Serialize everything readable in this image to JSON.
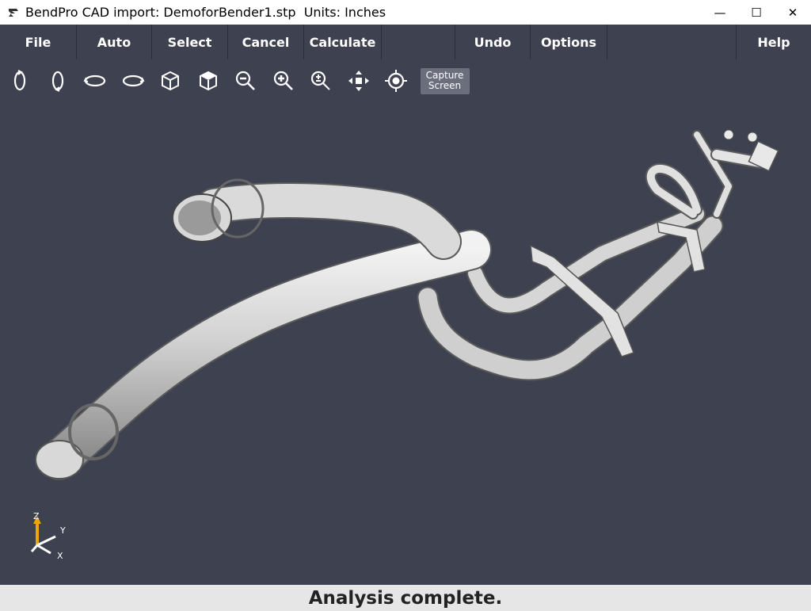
{
  "window": {
    "title": "BendPro CAD import: DemoforBender1.stp  Units: Inches",
    "minimize": "—",
    "maximize": "☐",
    "close": "✕"
  },
  "menu": {
    "items": [
      {
        "label": "File",
        "width": 97
      },
      {
        "label": "Auto",
        "width": 95
      },
      {
        "label": "Select",
        "width": 96
      },
      {
        "label": "Cancel",
        "width": 96
      },
      {
        "label": "Calculate",
        "width": 98
      },
      {
        "label": "",
        "width": 93
      },
      {
        "label": "Undo",
        "width": 95
      },
      {
        "label": "Options",
        "width": 97
      },
      {
        "label": "",
        "width": 163
      },
      {
        "label": "Help",
        "width": 94
      }
    ]
  },
  "toolbar": {
    "icons": [
      "rotate-vertical-left-icon",
      "rotate-vertical-right-icon",
      "rotate-horizontal-left-icon",
      "rotate-horizontal-right-icon",
      "iso-view-icon",
      "iso-view-alt-icon",
      "zoom-out-icon",
      "zoom-in-icon",
      "zoom-fit-icon",
      "pan-icon",
      "center-target-icon"
    ],
    "capture_line1": "Capture",
    "capture_line2": "Screen"
  },
  "axes": {
    "z": "Z",
    "y": "Y",
    "x": "X"
  },
  "status": {
    "text": "Analysis complete."
  },
  "colors": {
    "viewport_bg": "#3e414f",
    "pipe": "#d4d4d4",
    "axis_z": "#f2a20f",
    "status_bg": "#e6e6e6"
  }
}
